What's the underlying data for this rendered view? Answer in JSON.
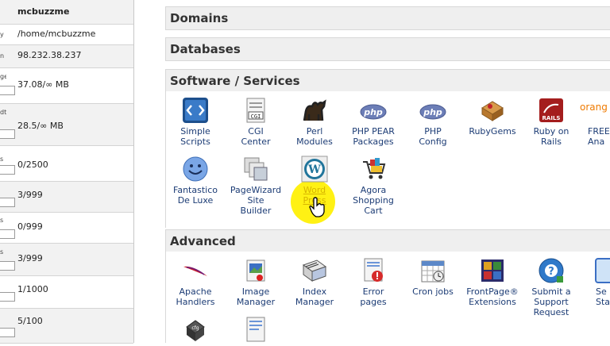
{
  "stats": {
    "rows": [
      {
        "label": "",
        "value": "mcbuzzme",
        "bold": true
      },
      {
        "label": "y",
        "value": "/home/mcbuzzme"
      },
      {
        "label": "n",
        "value": "98.232.38.237"
      },
      {
        "label": "ge",
        "value": "37.08/∞ MB",
        "box": true
      },
      {
        "label": "dth",
        "value": "28.5/∞ MB",
        "box": true
      },
      {
        "label": "s",
        "value": "0/2500",
        "box": true
      },
      {
        "label": "",
        "value": "3/999",
        "box": true
      },
      {
        "label": "s",
        "value": "0/999",
        "box": true
      },
      {
        "label": "s",
        "value": "3/999",
        "box": true
      },
      {
        "label": "",
        "value": "1/1000",
        "box": true
      },
      {
        "label": "",
        "value": "5/100",
        "box": true
      }
    ]
  },
  "sections": {
    "domains": "Domains",
    "databases": "Databases",
    "software": "Software / Services",
    "advanced": "Advanced"
  },
  "software_items": [
    {
      "label1": "Simple",
      "label2": "Scripts",
      "icon": "scripts-icon"
    },
    {
      "label1": "CGI",
      "label2": "Center",
      "icon": "cgi-icon"
    },
    {
      "label1": "Perl",
      "label2": "Modules",
      "icon": "perl-camel-icon"
    },
    {
      "label1": "PHP PEAR",
      "label2": "Packages",
      "icon": "php-icon"
    },
    {
      "label1": "PHP",
      "label2": "Config",
      "icon": "php-icon"
    },
    {
      "label1": "RubyGems",
      "label2": "",
      "icon": "rubygems-icon"
    },
    {
      "label1": "Ruby on",
      "label2": "Rails",
      "icon": "rails-icon"
    },
    {
      "label1": "FREE",
      "label2": "Ana",
      "icon": "orange-icon",
      "topword": "orang"
    },
    {
      "label1": "Fantastico",
      "label2": "De Luxe",
      "icon": "smiley-icon"
    },
    {
      "label1": "PageWizard",
      "label2": "Site",
      "label3": "Builder",
      "icon": "pagewizard-icon"
    },
    {
      "label1": "Word",
      "label2": "Press",
      "icon": "wordpress-icon",
      "highlight": true
    },
    {
      "label1": "Agora",
      "label2": "Shopping",
      "label3": "Cart",
      "icon": "cart-icon"
    }
  ],
  "advanced_items": [
    {
      "label1": "Apache",
      "label2": "Handlers",
      "icon": "apache-feather-icon"
    },
    {
      "label1": "Image",
      "label2": "Manager",
      "icon": "image-manager-icon"
    },
    {
      "label1": "Index",
      "label2": "Manager",
      "icon": "index-manager-icon"
    },
    {
      "label1": "Error",
      "label2": "pages",
      "icon": "error-pages-icon"
    },
    {
      "label1": "Cron jobs",
      "label2": "",
      "icon": "cron-icon"
    },
    {
      "label1": "FrontPage®",
      "label2": "Extensions",
      "icon": "frontpage-icon"
    },
    {
      "label1": "Submit a",
      "label2": "Support",
      "label3": "Request",
      "icon": "support-icon"
    },
    {
      "label1": "Se",
      "label2": "Sta",
      "icon": "server-icon"
    }
  ],
  "colors": {
    "link": "#1c3c75",
    "section_bg": "#efefef",
    "highlight": "#fff000"
  }
}
